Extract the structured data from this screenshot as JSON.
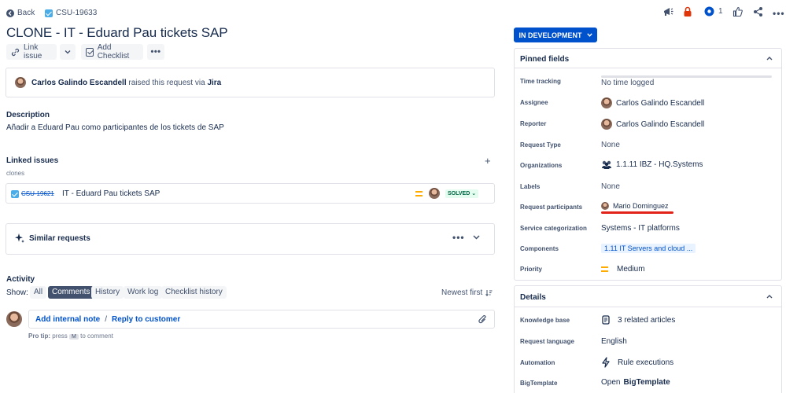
{
  "topbar": {
    "back_label": "Back",
    "issue_key": "CSU-19633",
    "watchers_count": "1"
  },
  "issue": {
    "title": "CLONE - IT - Eduard Pau tickets SAP"
  },
  "actions": {
    "link_issue": "Link issue",
    "add_checklist": "Add Checklist"
  },
  "raised": {
    "name": "Carlos Galindo Escandell",
    "text": "raised this request via",
    "via": "Jira"
  },
  "description": {
    "heading": "Description",
    "text": "Añadir a Eduard Pau como participantes de los tickets de SAP"
  },
  "linked": {
    "heading": "Linked issues",
    "relation": "clones",
    "issue_key": "CSU-19621",
    "summary": "IT - Eduard Pau tickets SAP",
    "status": "SOLVED"
  },
  "similar": {
    "label": "Similar requests"
  },
  "activity": {
    "heading": "Activity",
    "show_label": "Show:",
    "tabs": [
      "All",
      "Comments",
      "History",
      "Work log",
      "Checklist history"
    ],
    "active_tab": "Comments",
    "sort_label": "Newest first",
    "add_internal_note": "Add internal note",
    "separator": "/",
    "reply_to_customer": "Reply to customer",
    "pro_tip_prefix": "Pro tip:",
    "pro_tip_press": "press",
    "pro_tip_key": "M",
    "pro_tip_suffix": "to comment"
  },
  "status": {
    "label": "IN DEVELOPMENT"
  },
  "pinned": {
    "title": "Pinned fields",
    "fields": [
      {
        "label": "Time tracking",
        "value": "No time logged"
      },
      {
        "label": "Assignee",
        "value": "Carlos Galindo Escandell"
      },
      {
        "label": "Reporter",
        "value": "Carlos Galindo Escandell"
      },
      {
        "label": "Request Type",
        "value": "None"
      },
      {
        "label": "Organizations",
        "value": "1.1.11 IBZ - HQ.Systems"
      },
      {
        "label": "Labels",
        "value": "None"
      },
      {
        "label": "Request participants",
        "value": "Mario Dominguez"
      },
      {
        "label": "Service categorization",
        "value": "Systems - IT platforms"
      },
      {
        "label": "Components",
        "value": "1.11 IT Servers and cloud ..."
      },
      {
        "label": "Priority",
        "value": "Medium"
      }
    ]
  },
  "details": {
    "title": "Details",
    "fields": [
      {
        "label": "Knowledge base",
        "value": "3 related articles"
      },
      {
        "label": "Request language",
        "value": "English"
      },
      {
        "label": "Automation",
        "value": "Rule executions"
      },
      {
        "label": "BigTemplate",
        "value_prefix": "Open",
        "value_bold": "BigTemplate"
      }
    ]
  },
  "colors": {
    "accent": "#0052cc",
    "status_solved_bg": "#e3fcef",
    "status_solved_text": "#006644",
    "priority_medium": "#ffab00",
    "annotation_red": "#e2231a"
  },
  "icons": [
    "back-arrow-icon",
    "issue-type-icon",
    "megaphone-icon",
    "lock-icon",
    "eye-icon",
    "thumbs-up-icon",
    "share-icon",
    "more-icon",
    "link-icon",
    "chevron-down-icon",
    "checklist-icon",
    "plus-icon",
    "sparkle-icon",
    "sort-icon",
    "paperclip-icon",
    "organization-icon",
    "knowledge-base-icon",
    "lightning-icon",
    "chevron-up-icon"
  ]
}
